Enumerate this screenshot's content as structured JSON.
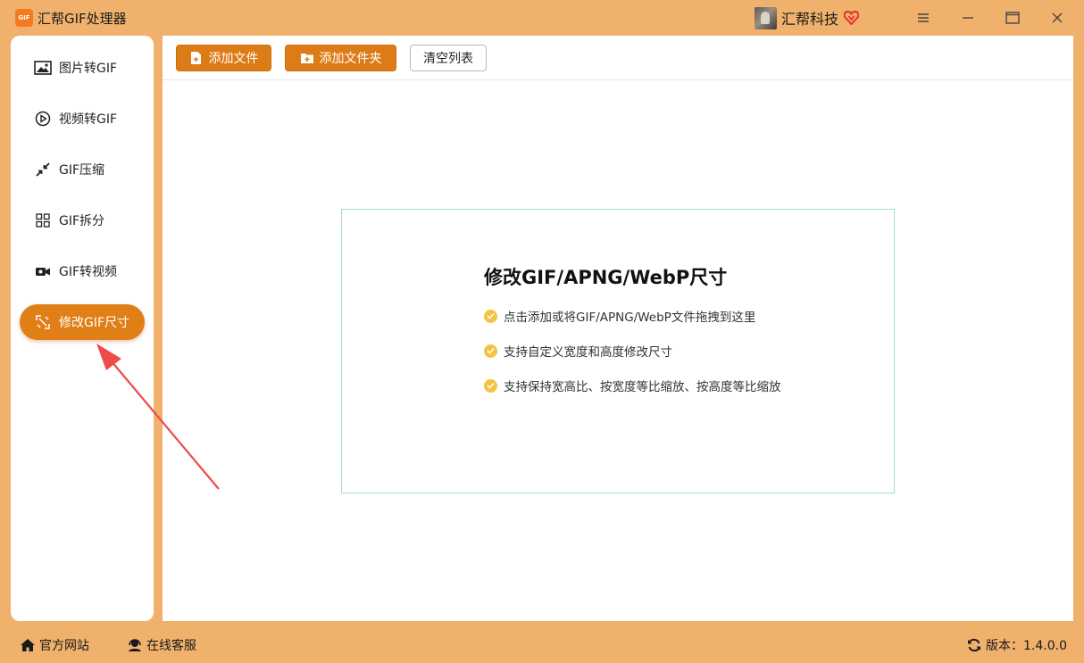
{
  "app": {
    "title": "汇帮GIF处理器",
    "logo_text": "GIF",
    "user_name": "汇帮科技"
  },
  "window_controls": {
    "menu_icon": "menu-icon",
    "minimize_icon": "minimize-icon",
    "maximize_icon": "maximize-icon",
    "close_icon": "close-icon"
  },
  "sidebar": {
    "items": [
      {
        "label": "图片转GIF",
        "icon": "image-icon",
        "active": false
      },
      {
        "label": "视频转GIF",
        "icon": "play-circle-icon",
        "active": false
      },
      {
        "label": "GIF压缩",
        "icon": "compress-icon",
        "active": false
      },
      {
        "label": "GIF拆分",
        "icon": "split-icon",
        "active": false
      },
      {
        "label": "GIF转视频",
        "icon": "video-camera-icon",
        "active": false
      },
      {
        "label": "修改GIF尺寸",
        "icon": "resize-icon",
        "active": true
      }
    ]
  },
  "toolbar": {
    "add_file": "添加文件",
    "add_folder": "添加文件夹",
    "clear_list": "清空列表"
  },
  "dropzone": {
    "title": "修改GIF/APNG/WebP尺寸",
    "features": [
      "点击添加或将GIF/APNG/WebP文件拖拽到这里",
      "支持自定义宽度和高度修改尺寸",
      "支持保持宽高比、按宽度等比缩放、按高度等比缩放"
    ]
  },
  "statusbar": {
    "website": "官方网站",
    "support": "在线客服",
    "version": "版本：1.4.0.0"
  },
  "colors": {
    "accent": "#dd7c16",
    "background": "#f0b16c",
    "check": "#f5c243",
    "dropzone_border": "#9edcd8",
    "annotation_arrow": "#ee4b4b"
  }
}
